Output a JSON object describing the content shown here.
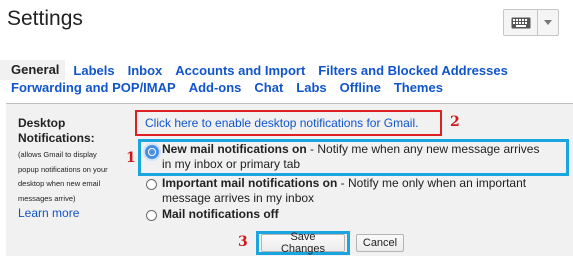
{
  "header": {
    "title": "Settings",
    "keyboard_icon": "keyboard-icon",
    "dropdown_icon": "chevron-down-icon"
  },
  "tabs": {
    "row1": [
      "General",
      "Labels",
      "Inbox",
      "Accounts and Import",
      "Filters and Blocked Addresses"
    ],
    "row2": [
      "Forwarding and POP/IMAP",
      "Add-ons",
      "Chat",
      "Labs",
      "Offline",
      "Themes"
    ],
    "active": "General"
  },
  "desktop_notifications": {
    "heading_line1": "Desktop",
    "heading_line2": "Notifications:",
    "desc_lines": [
      "(allows Gmail to display",
      "popup notifications on your",
      "desktop when new email",
      "messages arrive)"
    ],
    "learn_more": "Learn more",
    "enable_link": "Click here to enable desktop notifications for Gmail.",
    "options": [
      {
        "bold": "New mail notifications on",
        "rest_line1": " - Notify me when any new message arrives",
        "rest_line2": "in my inbox or primary tab",
        "selected": true
      },
      {
        "bold": "Important mail notifications on",
        "rest_line1": " - Notify me only when an important",
        "rest_line2": "message arrives in my inbox",
        "selected": false
      },
      {
        "bold": "Mail notifications off",
        "rest_line1": "",
        "rest_line2": "",
        "selected": false
      }
    ]
  },
  "annotations": {
    "marker1": "1",
    "marker2": "2",
    "marker3": "3",
    "red": "#e02020",
    "blue": "#1aa5e0"
  },
  "buttons": {
    "save": "Save Changes",
    "cancel": "Cancel"
  },
  "colors": {
    "link": "#1155cc",
    "panel_bg": "#f1f1f1"
  }
}
